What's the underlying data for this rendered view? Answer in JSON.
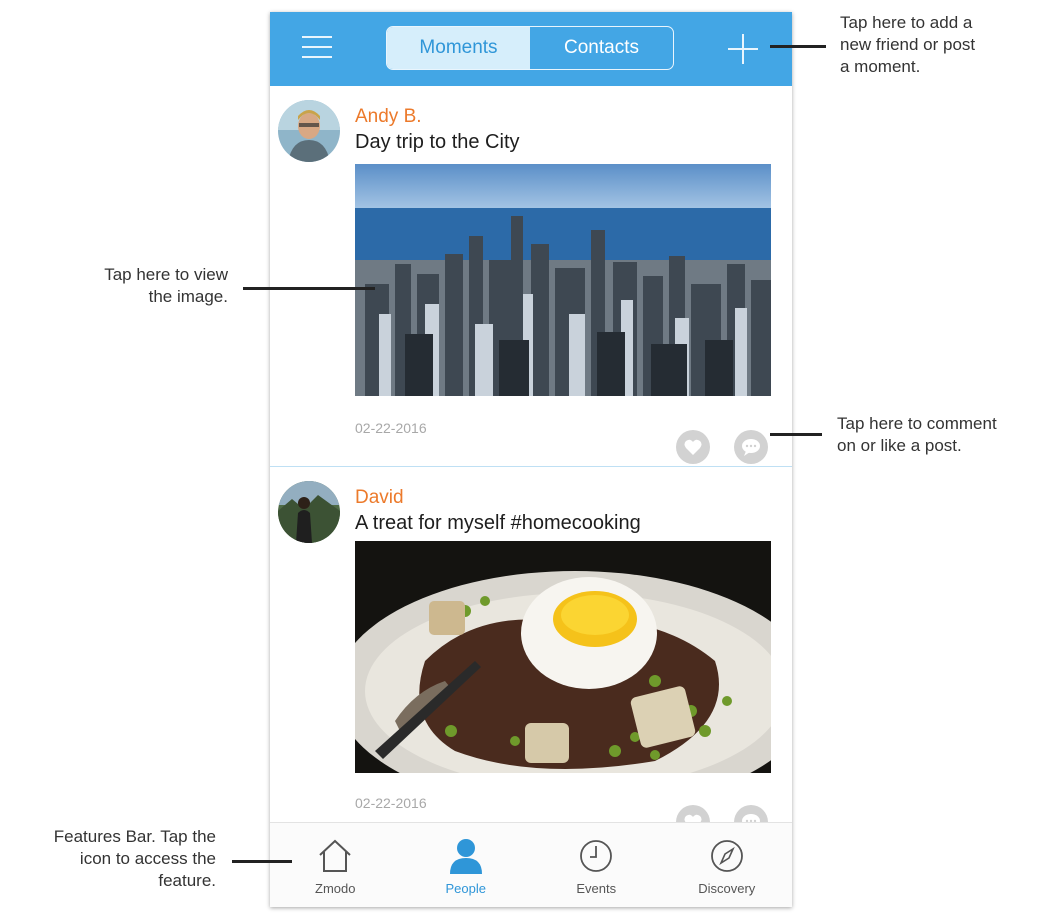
{
  "header": {
    "tabs": [
      {
        "label": "Moments",
        "active": true
      },
      {
        "label": "Contacts",
        "active": false
      }
    ],
    "menu_icon": "hamburger-icon",
    "add_icon": "plus-icon"
  },
  "feed": [
    {
      "user": "Andy B.",
      "caption": "Day trip to the City",
      "date": "02-22-2016",
      "image": "city-skyline-photo"
    },
    {
      "user": "David",
      "caption": "A treat for myself #homecooking",
      "date": "02-22-2016",
      "image": "steak-and-egg-photo"
    }
  ],
  "nav": [
    {
      "label": "Zmodo",
      "icon": "home-icon",
      "active": false
    },
    {
      "label": "People",
      "icon": "person-icon",
      "active": true
    },
    {
      "label": "Events",
      "icon": "clock-icon",
      "active": false
    },
    {
      "label": "Discovery",
      "icon": "compass-icon",
      "active": false
    }
  ],
  "annotations": {
    "add": [
      "Tap here to add a",
      "new friend or post",
      "a moment."
    ],
    "image": [
      "Tap here to view",
      "the image."
    ],
    "comment": [
      "Tap here to comment",
      "on or like a post."
    ],
    "features": [
      "Features Bar. Tap the",
      "icon to access the",
      "feature."
    ]
  },
  "colors": {
    "accent": "#43a6e5",
    "username": "#ec7a2b",
    "active_tab": "#2f96d8"
  }
}
